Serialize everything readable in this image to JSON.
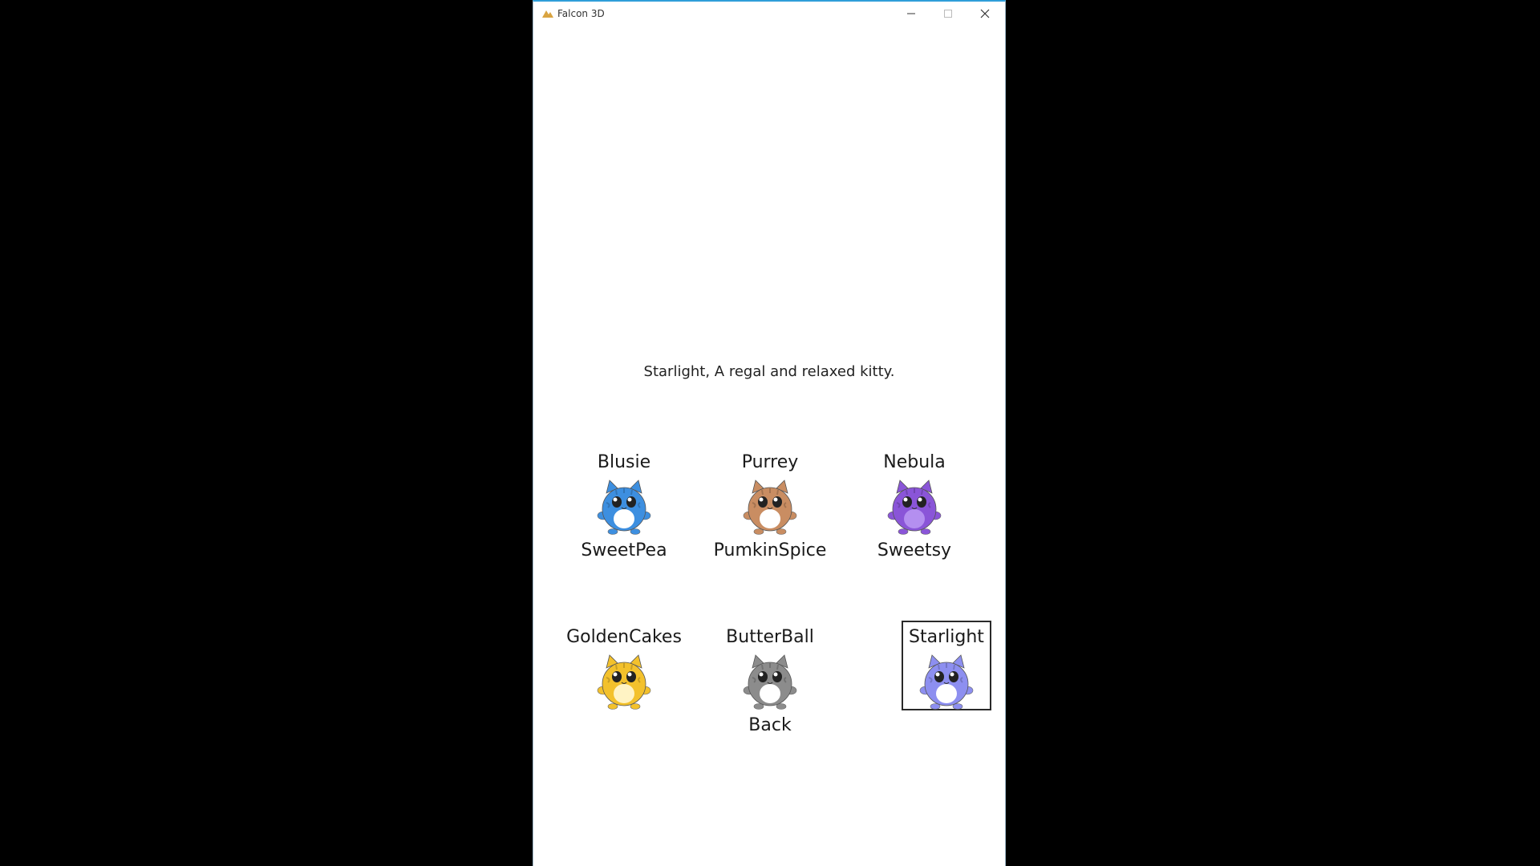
{
  "window": {
    "title": "Falcon 3D",
    "controls": {
      "minimize": "minimize-icon",
      "maximize": "maximize-icon",
      "close": "close-icon"
    }
  },
  "description": "Starlight, A regal and relaxed kitty.",
  "cats_row1": [
    {
      "name": "Blusie",
      "color": "#3d8fe0",
      "belly": "#ffffff"
    },
    {
      "name": "Purrey",
      "color": "#c98d62",
      "belly": "#ffffff"
    },
    {
      "name": "Nebula",
      "color": "#8a55d8",
      "belly": "#b48ff0"
    }
  ],
  "labels_row1": [
    "SweetPea",
    "PumkinSpice",
    "Sweetsy"
  ],
  "cats_row2": [
    {
      "name": "GoldenCakes",
      "color": "#f3c12c",
      "belly": "#fff3c4"
    },
    {
      "name": "ButterBall",
      "color": "#8c8c8c",
      "belly": "#ffffff"
    },
    {
      "name": "Starlight",
      "color": "#8d8ff0",
      "belly": "#ffffff",
      "selected": true
    }
  ],
  "back_label": "Back",
  "accent": "#2f9ed9"
}
